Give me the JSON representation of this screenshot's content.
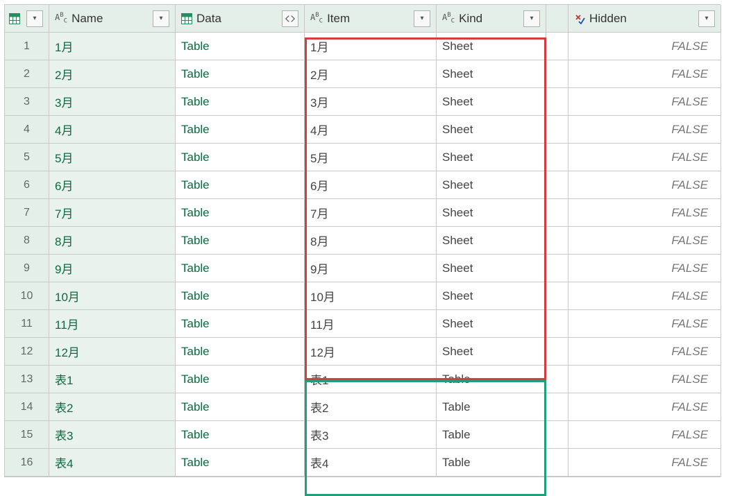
{
  "columns": {
    "name": {
      "label": "Name",
      "type": "text"
    },
    "data": {
      "label": "Data",
      "type": "table"
    },
    "item": {
      "label": "Item",
      "type": "text"
    },
    "kind": {
      "label": "Kind",
      "type": "text"
    },
    "hidden": {
      "label": "Hidden",
      "type": "bool"
    }
  },
  "chart_data": {
    "type": "table",
    "columns": [
      "Name",
      "Data",
      "Item",
      "Kind",
      "Hidden"
    ],
    "rows": [
      {
        "num": 1,
        "name": "1月",
        "data": "Table",
        "item": "1月",
        "kind": "Sheet",
        "hidden": "FALSE"
      },
      {
        "num": 2,
        "name": "2月",
        "data": "Table",
        "item": "2月",
        "kind": "Sheet",
        "hidden": "FALSE"
      },
      {
        "num": 3,
        "name": "3月",
        "data": "Table",
        "item": "3月",
        "kind": "Sheet",
        "hidden": "FALSE"
      },
      {
        "num": 4,
        "name": "4月",
        "data": "Table",
        "item": "4月",
        "kind": "Sheet",
        "hidden": "FALSE"
      },
      {
        "num": 5,
        "name": "5月",
        "data": "Table",
        "item": "5月",
        "kind": "Sheet",
        "hidden": "FALSE"
      },
      {
        "num": 6,
        "name": "6月",
        "data": "Table",
        "item": "6月",
        "kind": "Sheet",
        "hidden": "FALSE"
      },
      {
        "num": 7,
        "name": "7月",
        "data": "Table",
        "item": "7月",
        "kind": "Sheet",
        "hidden": "FALSE"
      },
      {
        "num": 8,
        "name": "8月",
        "data": "Table",
        "item": "8月",
        "kind": "Sheet",
        "hidden": "FALSE"
      },
      {
        "num": 9,
        "name": "9月",
        "data": "Table",
        "item": "9月",
        "kind": "Sheet",
        "hidden": "FALSE"
      },
      {
        "num": 10,
        "name": "10月",
        "data": "Table",
        "item": "10月",
        "kind": "Sheet",
        "hidden": "FALSE"
      },
      {
        "num": 11,
        "name": "11月",
        "data": "Table",
        "item": "11月",
        "kind": "Sheet",
        "hidden": "FALSE"
      },
      {
        "num": 12,
        "name": "12月",
        "data": "Table",
        "item": "12月",
        "kind": "Sheet",
        "hidden": "FALSE"
      },
      {
        "num": 13,
        "name": "表1",
        "data": "Table",
        "item": "表1",
        "kind": "Table",
        "hidden": "FALSE"
      },
      {
        "num": 14,
        "name": "表2",
        "data": "Table",
        "item": "表2",
        "kind": "Table",
        "hidden": "FALSE"
      },
      {
        "num": 15,
        "name": "表3",
        "data": "Table",
        "item": "表3",
        "kind": "Table",
        "hidden": "FALSE"
      },
      {
        "num": 16,
        "name": "表4",
        "data": "Table",
        "item": "表4",
        "kind": "Table",
        "hidden": "FALSE"
      }
    ]
  }
}
